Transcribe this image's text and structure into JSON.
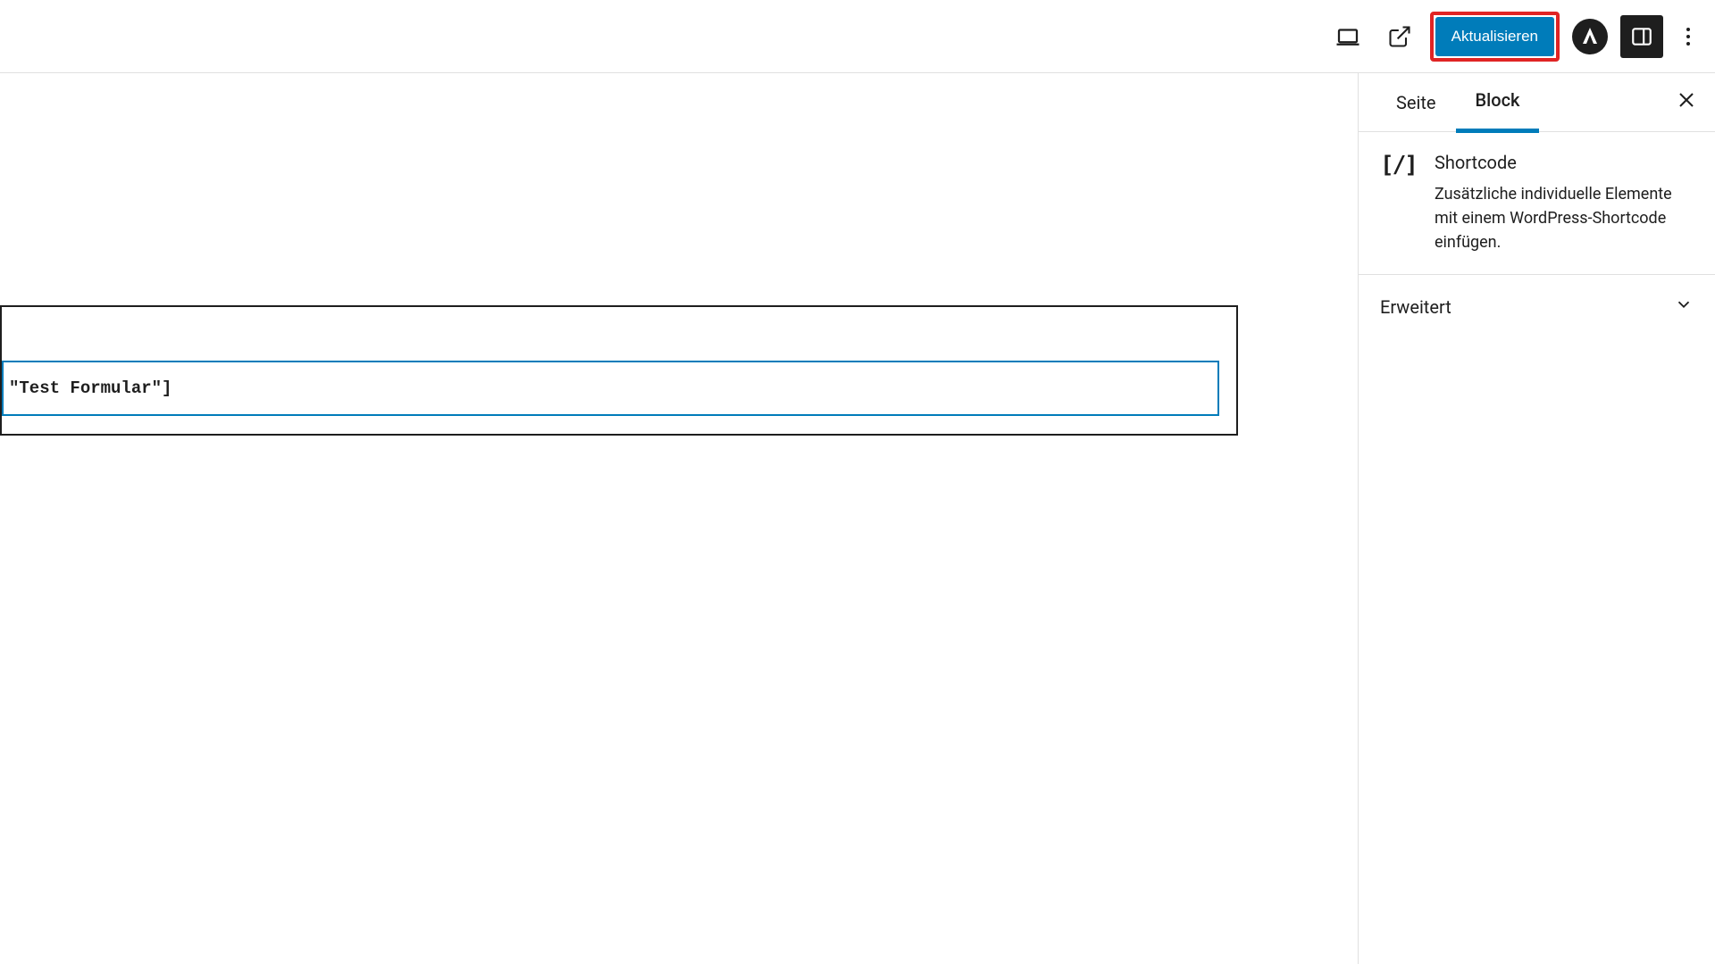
{
  "header": {
    "update_label": "Aktualisieren"
  },
  "sidebar": {
    "tabs": {
      "page": "Seite",
      "block": "Block"
    },
    "block": {
      "title": "Shortcode",
      "description": "Zusätzliche individuelle Elemente mit einem WordPress-Shortcode einfügen."
    },
    "panels": {
      "advanced": "Erweitert"
    }
  },
  "editor": {
    "shortcode_value": "\"Test Formular\"]"
  }
}
